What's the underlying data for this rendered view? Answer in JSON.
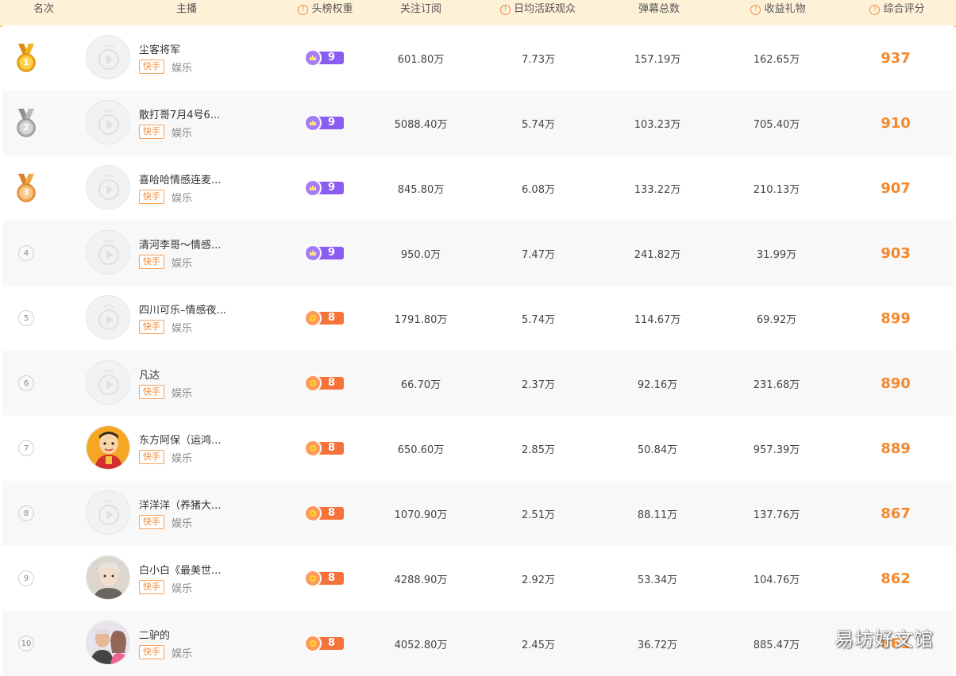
{
  "columns": {
    "rank": "名次",
    "anchor": "主播",
    "weight": "头榜权重",
    "followers": "关注订阅",
    "daily_viewers": "日均活跃观众",
    "danmaku": "弹幕总数",
    "gifts": "收益礼物",
    "score": "综合评分"
  },
  "colors": {
    "header_bg": "#fdf1d8",
    "accent_orange": "#f5882d",
    "badge_purple": "#8a5cf2",
    "badge_orange": "#f5733a",
    "gold_medal": "#f0b420",
    "silver_medal": "#b5b5b5",
    "bronze_medal": "#f0a850"
  },
  "rows": [
    {
      "rank": "1",
      "medal": "gold",
      "name": "尘客将军",
      "platform": "快手",
      "category": "娱乐",
      "weight": "9",
      "weight_tier": "purple",
      "followers": "601.80万",
      "daily_viewers": "7.73万",
      "danmaku": "157.19万",
      "gifts": "162.65万",
      "score": "937",
      "avatar": "placeholder"
    },
    {
      "rank": "2",
      "medal": "silver",
      "name": "散打哥7月4号6...",
      "platform": "快手",
      "category": "娱乐",
      "weight": "9",
      "weight_tier": "purple",
      "followers": "5088.40万",
      "daily_viewers": "5.74万",
      "danmaku": "103.23万",
      "gifts": "705.40万",
      "score": "910",
      "avatar": "placeholder"
    },
    {
      "rank": "3",
      "medal": "bronze",
      "name": "喜哈哈情感连麦...",
      "platform": "快手",
      "category": "娱乐",
      "weight": "9",
      "weight_tier": "purple",
      "followers": "845.80万",
      "daily_viewers": "6.08万",
      "danmaku": "133.22万",
      "gifts": "210.13万",
      "score": "907",
      "avatar": "placeholder"
    },
    {
      "rank": "4",
      "medal": "",
      "name": "清河李哥～情感...",
      "platform": "快手",
      "category": "娱乐",
      "weight": "9",
      "weight_tier": "purple",
      "followers": "950.0万",
      "daily_viewers": "7.47万",
      "danmaku": "241.82万",
      "gifts": "31.99万",
      "score": "903",
      "avatar": "placeholder"
    },
    {
      "rank": "5",
      "medal": "",
      "name": "四川可乐–情感夜...",
      "platform": "快手",
      "category": "娱乐",
      "weight": "8",
      "weight_tier": "orange",
      "followers": "1791.80万",
      "daily_viewers": "5.74万",
      "danmaku": "114.67万",
      "gifts": "69.92万",
      "score": "899",
      "avatar": "placeholder"
    },
    {
      "rank": "6",
      "medal": "",
      "name": "凡达",
      "platform": "快手",
      "category": "娱乐",
      "weight": "8",
      "weight_tier": "orange",
      "followers": "66.70万",
      "daily_viewers": "2.37万",
      "danmaku": "92.16万",
      "gifts": "231.68万",
      "score": "890",
      "avatar": "placeholder"
    },
    {
      "rank": "7",
      "medal": "",
      "name": "东方阿保（运鸿...",
      "platform": "快手",
      "category": "娱乐",
      "weight": "8",
      "weight_tier": "orange",
      "followers": "650.60万",
      "daily_viewers": "2.85万",
      "danmaku": "50.84万",
      "gifts": "957.39万",
      "score": "889",
      "avatar": "cartoon"
    },
    {
      "rank": "8",
      "medal": "",
      "name": "洋洋洋（养猪大...",
      "platform": "快手",
      "category": "娱乐",
      "weight": "8",
      "weight_tier": "orange",
      "followers": "1070.90万",
      "daily_viewers": "2.51万",
      "danmaku": "88.11万",
      "gifts": "137.76万",
      "score": "867",
      "avatar": "placeholder"
    },
    {
      "rank": "9",
      "medal": "",
      "name": "白小白《最美世...",
      "platform": "快手",
      "category": "娱乐",
      "weight": "8",
      "weight_tier": "orange",
      "followers": "4288.90万",
      "daily_viewers": "2.92万",
      "danmaku": "53.34万",
      "gifts": "104.76万",
      "score": "862",
      "avatar": "photo"
    },
    {
      "rank": "10",
      "medal": "",
      "name": "二驴的",
      "platform": "快手",
      "category": "娱乐",
      "weight": "8",
      "weight_tier": "orange",
      "followers": "4052.80万",
      "daily_viewers": "2.45万",
      "danmaku": "36.72万",
      "gifts": "885.47万",
      "score": "861",
      "avatar": "photo2"
    }
  ],
  "watermark": "易坊好文馆"
}
